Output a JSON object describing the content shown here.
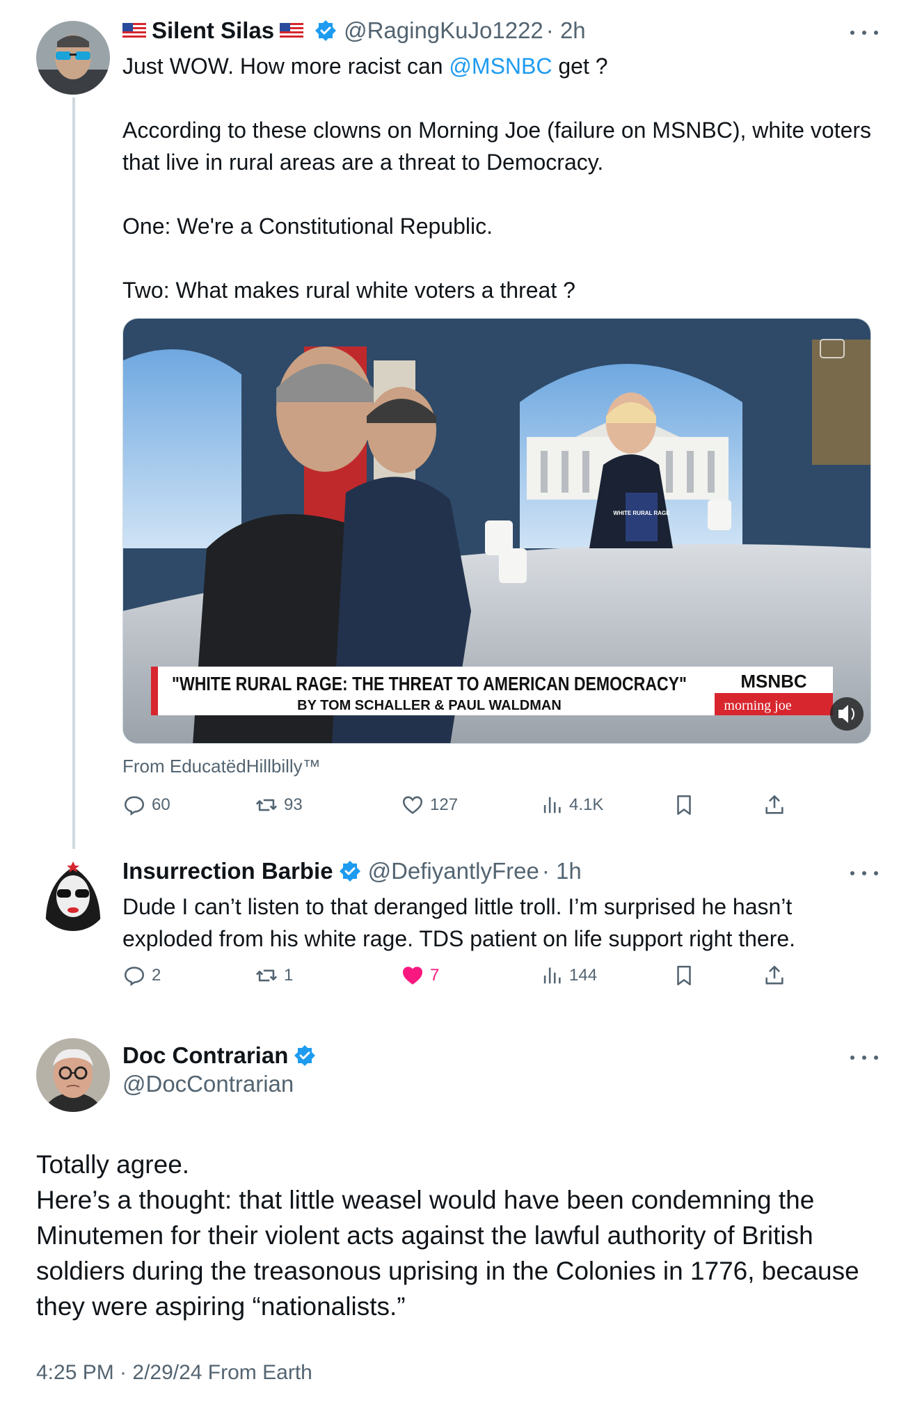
{
  "tweets": [
    {
      "display_name": "Silent Silas",
      "handle": "@RagingKuJo1222",
      "time": "· 2h",
      "mention": "@MSNBC",
      "text_prefix": "Just WOW. How more racist can ",
      "text_suffix": " get ?",
      "body": "According to these clowns on Morning Joe (failure on MSNBC), white voters that live in rural areas are a threat to Democracy.\n\nOne: We're a Constitutional Republic.\n\nTwo: What makes rural white voters a threat ?",
      "media": {
        "banner_title": "\"WHITE RURAL RAGE: THE THREAT TO AMERICAN DEMOCRACY\"",
        "banner_subtitle": "BY TOM SCHALLER & PAUL WALDMAN",
        "network": "MSNBC",
        "show": "morning joe",
        "book_label": "WHITE RURAL RAGE"
      },
      "source": "From EducatëdHillbilly™",
      "stats": {
        "replies": "60",
        "reposts": "93",
        "likes": "127",
        "views": "4.1K"
      }
    },
    {
      "display_name": "Insurrection Barbie",
      "handle": "@DefiyantlyFree",
      "time": "· 1h",
      "text": "Dude I can’t listen to that deranged little troll. I’m surprised he hasn’t exploded from his white rage. TDS patient on life support right there.",
      "stats": {
        "replies": "2",
        "reposts": "1",
        "likes": "7",
        "views": "144"
      }
    },
    {
      "display_name": "Doc Contrarian",
      "handle": "@DocContrarian",
      "text": "Totally agree.\nHere’s a thought: that little weasel would have been condemning the Minutemen for their violent acts against the lawful authority of British soldiers during the treasonous uprising in the Colonies in 1776, because they were aspiring “nationalists.”",
      "meta": "4:25 PM · 2/29/24 From Earth"
    }
  ],
  "colors": {
    "accent": "#1d9bf0",
    "like": "#f91880",
    "muted": "#536471",
    "msnbc_red": "#d7262e"
  },
  "icons": [
    "reply-icon",
    "repost-icon",
    "like-icon",
    "views-icon",
    "bookmark-icon",
    "share-icon",
    "verified-icon",
    "more-icon",
    "us-flag-icon",
    "volume-icon"
  ]
}
